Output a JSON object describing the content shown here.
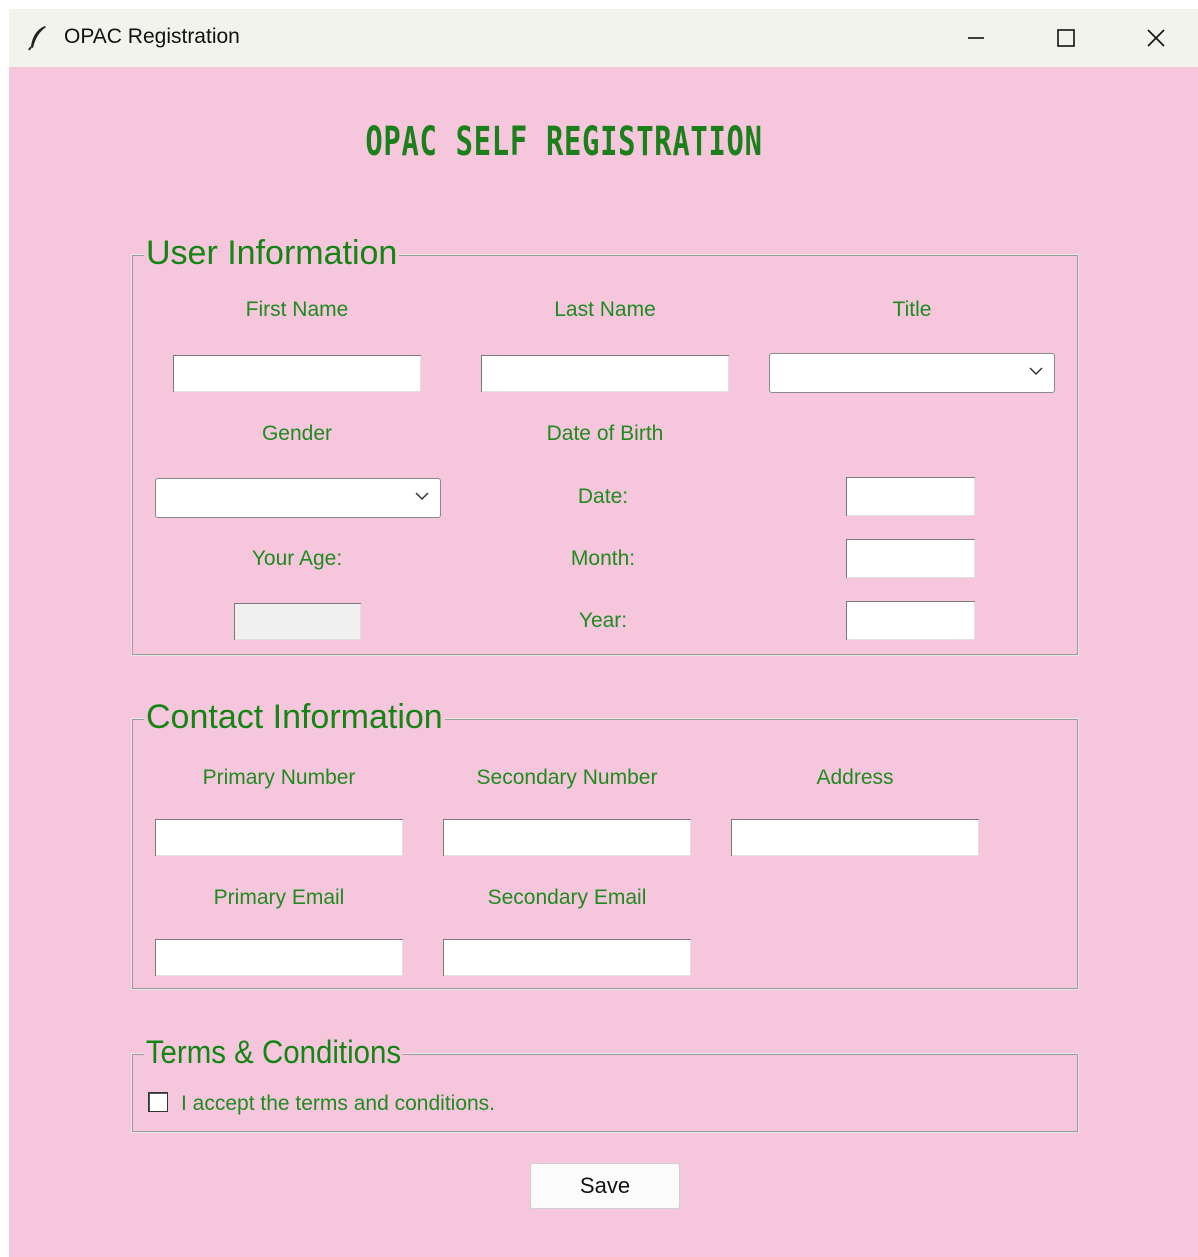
{
  "window": {
    "title": "OPAC Registration"
  },
  "page_title": "OPAC SELF REGISTRATION",
  "user_info": {
    "legend": "User Information",
    "first_name_label": "First Name",
    "last_name_label": "Last Name",
    "title_label": "Title",
    "gender_label": "Gender",
    "dob_label": "Date of Birth",
    "date_label": "Date:",
    "month_label": "Month:",
    "year_label": "Year:",
    "age_label": "Your Age:",
    "first_name_value": "",
    "last_name_value": "",
    "title_value": "",
    "gender_value": "",
    "date_value": "",
    "month_value": "",
    "year_value": "",
    "age_value": ""
  },
  "contact_info": {
    "legend": "Contact Information",
    "primary_number_label": "Primary Number",
    "secondary_number_label": "Secondary Number",
    "address_label": "Address",
    "primary_email_label": "Primary Email",
    "secondary_email_label": "Secondary Email"
  },
  "terms": {
    "legend": "Terms & Conditions",
    "checkbox_label": "I accept the terms and conditions.",
    "checked": false
  },
  "save_label": "Save",
  "icons": {
    "app": "feather-icon",
    "minimize": "minimize-icon",
    "maximize": "maximize-icon",
    "close": "close-icon",
    "dropdown": "chevron-down-icon"
  },
  "colors": {
    "background": "#f6c7dc",
    "label": "#1f8a1f",
    "title": "#1b7f1b"
  }
}
